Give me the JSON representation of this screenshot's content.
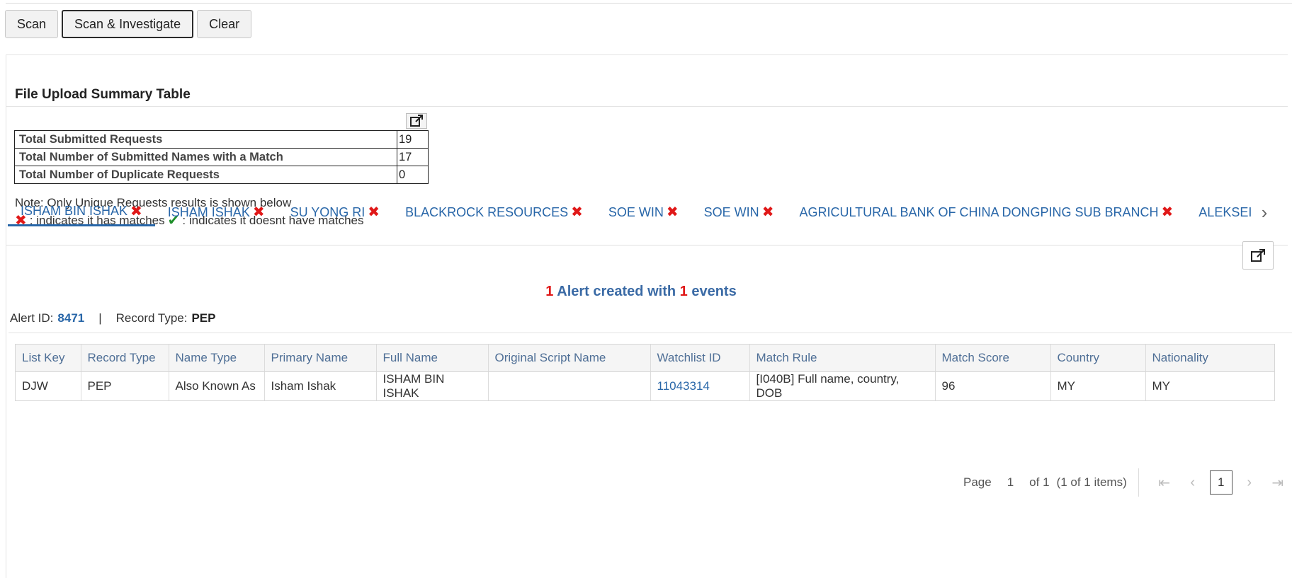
{
  "toolbar": {
    "scan_label": "Scan",
    "scan_investigate_label": "Scan & Investigate",
    "clear_label": "Clear"
  },
  "summary": {
    "title": "File Upload Summary Table",
    "rows": [
      {
        "label": "Total Submitted Requests",
        "value": "19"
      },
      {
        "label": "Total Number of Submitted Names with a Match",
        "value": "17"
      },
      {
        "label": "Total Number of Duplicate Requests",
        "value": "0"
      }
    ],
    "note": "Note: Only Unique Requests results is shown below",
    "legend_match": ": indicates it has matches",
    "legend_nomatch": ": indicates it doesnt have matches"
  },
  "tabs": [
    {
      "label": "ISHAM BIN ISHAK"
    },
    {
      "label": "ISHAM ISHAK"
    },
    {
      "label": "SU YONG RI"
    },
    {
      "label": "BLACKROCK RESOURCES"
    },
    {
      "label": "SOE WIN"
    },
    {
      "label": "SOE WIN"
    },
    {
      "label": "AGRICULTURAL BANK OF CHINA DONGPING SUB BRANCH"
    },
    {
      "label": "ALEKSEI VASILIEVICH"
    }
  ],
  "alert": {
    "count": "1",
    "text_mid": "Alert created with",
    "events": "1",
    "text_end": "events",
    "id_label": "Alert ID:",
    "id_value": "8471",
    "separator": "|",
    "record_type_label": "Record Type:",
    "record_type_value": "PEP"
  },
  "grid": {
    "headers": [
      "List Key",
      "Record Type",
      "Name Type",
      "Primary Name",
      "Full Name",
      "Original Script Name",
      "Watchlist ID",
      "Match Rule",
      "Match Score",
      "Country",
      "Nationality"
    ],
    "rows": [
      [
        "DJW",
        "PEP",
        "Also Known As",
        "Isham Ishak",
        "ISHAM BIN ISHAK",
        "",
        "11043314",
        "[I040B] Full name, country, DOB",
        "96",
        "MY",
        "MY"
      ]
    ]
  },
  "pager": {
    "page_label": "Page",
    "page_value": "1",
    "of_label": "of 1",
    "items_label": "(1 of 1 items)",
    "current": "1"
  },
  "colors": {
    "link": "#2866a8",
    "match_x": "#e01818",
    "no_match_check": "#1f8f2a"
  }
}
